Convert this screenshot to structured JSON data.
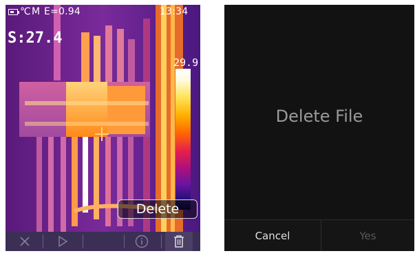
{
  "left_screen": {
    "status_bar": {
      "unit": "℃",
      "mode": "M",
      "emissivity": "E=0.94",
      "time": "13:34"
    },
    "spot_reading": "S:27.4",
    "scale_max": "29.9",
    "popup_label": "Delete",
    "toolbar": {
      "icons": [
        "close-icon",
        "play-icon",
        "info-icon",
        "trash-icon"
      ]
    }
  },
  "right_screen": {
    "dialog_title": "Delete File",
    "cancel_label": "Cancel",
    "yes_label": "Yes"
  }
}
